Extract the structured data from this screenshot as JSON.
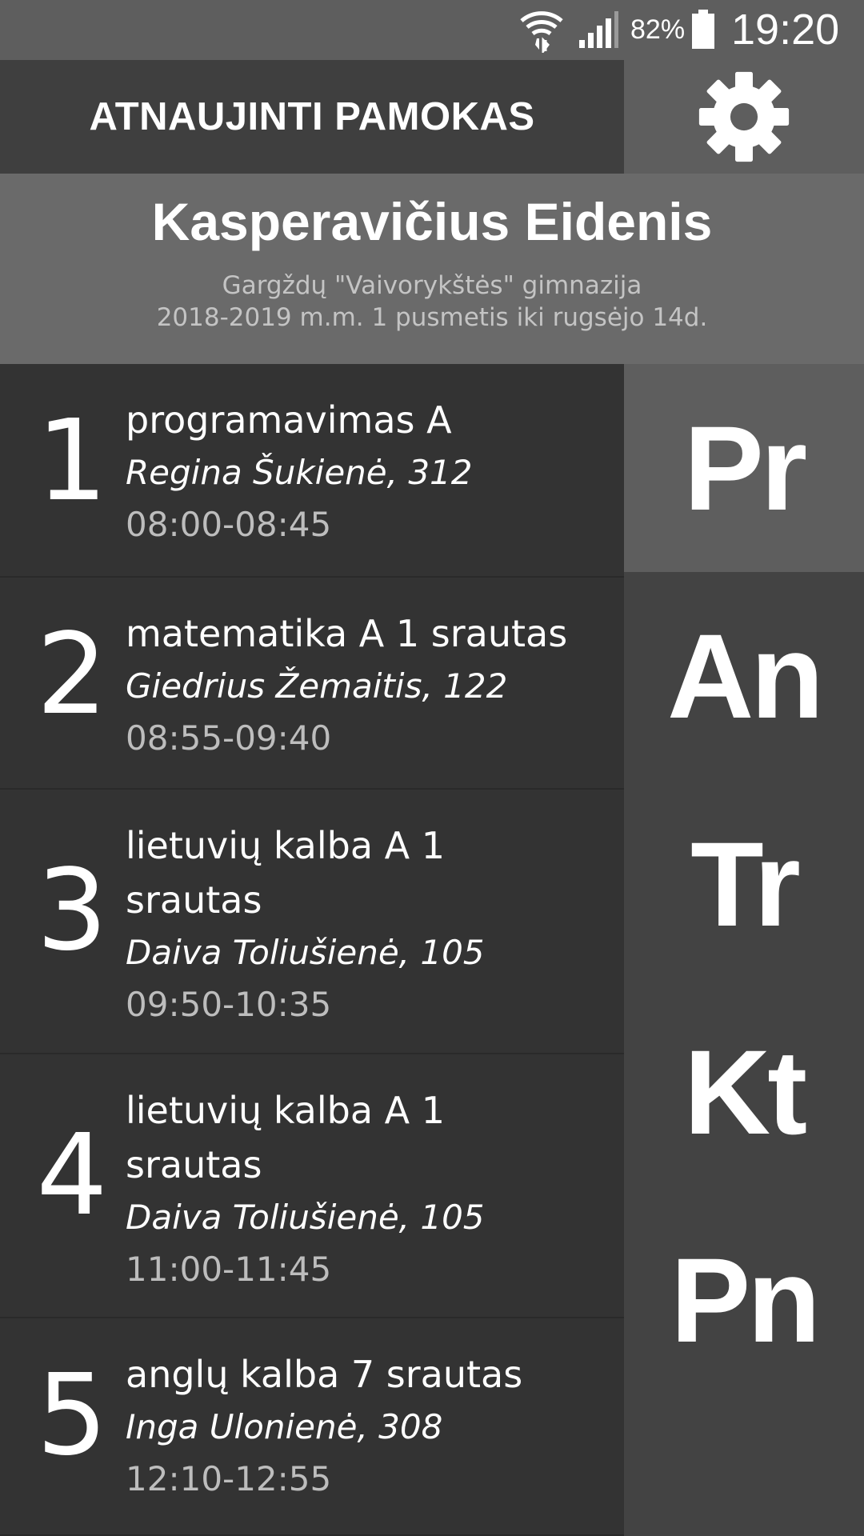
{
  "status_bar": {
    "battery_percent": "82%",
    "time": "19:20",
    "icons": [
      "wifi-icon",
      "signal-icon",
      "battery-icon"
    ]
  },
  "header": {
    "update_button_label": "ATNAUJINTI PAMOKAS",
    "settings_icon": "gear-icon"
  },
  "profile": {
    "name": "Kasperavičius Eidenis",
    "school": "Gargždų \"Vaivorykštės\" gimnazija",
    "period": "2018-2019 m.m. 1 pusmetis iki rugsėjo 14d."
  },
  "lessons": [
    {
      "number": "1",
      "subject_line1": "programavimas A",
      "subject_line2": "",
      "teacher": "Regina Šukienė, 312",
      "time": "08:00-08:45"
    },
    {
      "number": "2",
      "subject_line1": "matematika A 1 srautas",
      "subject_line2": "",
      "teacher": "Giedrius Žemaitis, 122",
      "time": "08:55-09:40"
    },
    {
      "number": "3",
      "subject_line1": "lietuvių kalba A 1",
      "subject_line2": "srautas",
      "teacher": "Daiva Toliušienė, 105",
      "time": "09:50-10:35"
    },
    {
      "number": "4",
      "subject_line1": "lietuvių kalba A 1",
      "subject_line2": "srautas",
      "teacher": "Daiva Toliušienė, 105",
      "time": "11:00-11:45"
    },
    {
      "number": "5",
      "subject_line1": "anglų kalba 7 srautas",
      "subject_line2": "",
      "teacher": "Inga Ulonienė, 308",
      "time": "12:10-12:55"
    }
  ],
  "days": {
    "selected": "Pr",
    "items": [
      "Pr",
      "An",
      "Tr",
      "Kt",
      "Pn"
    ]
  },
  "colors": {
    "status_bar": "#5e5e5e",
    "update_button": "#3f3f3f",
    "profile_bg": "#6a6a6a",
    "lesson_bg": "#333333",
    "day_panel": "#434343",
    "day_selected": "#5e5e5e",
    "time_text": "#bdbdbd"
  }
}
